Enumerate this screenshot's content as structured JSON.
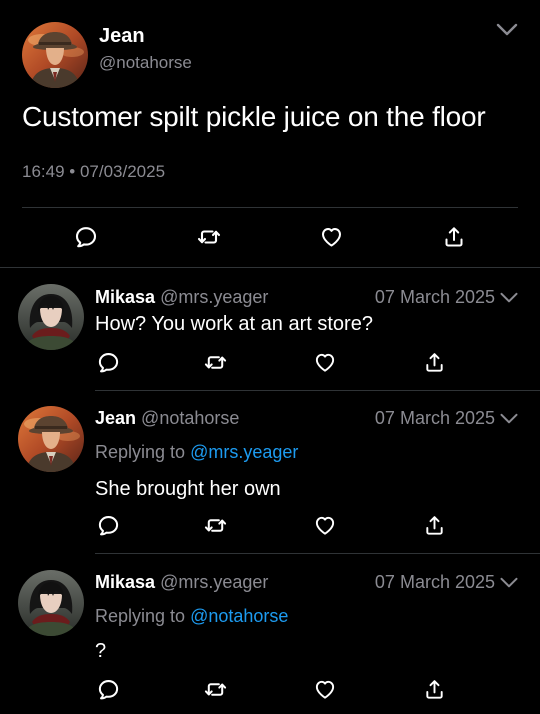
{
  "main_tweet": {
    "author_name": "Jean",
    "author_handle": "@notahorse",
    "text": "Customer spilt pickle juice on the floor",
    "timestamp": "16:49 • 07/03/2025",
    "icons": [
      "reply-icon",
      "retweet-icon",
      "like-icon",
      "share-icon"
    ]
  },
  "replies": [
    {
      "author_name": "Mikasa",
      "author_handle": "@mrs.yeager",
      "date": "07 March 2025",
      "replying_prefix": "",
      "replying_to": "",
      "text": "How? You work at an art store?"
    },
    {
      "author_name": "Jean",
      "author_handle": "@notahorse",
      "date": "07 March 2025",
      "replying_prefix": "Replying to",
      "replying_to": "@mrs.yeager",
      "text": "She brought her own"
    },
    {
      "author_name": "Mikasa",
      "author_handle": "@mrs.yeager",
      "date": "07 March 2025",
      "replying_prefix": "Replying to",
      "replying_to": "@notahorse",
      "text": "?"
    }
  ],
  "colors": {
    "background": "#000000",
    "primary_text": "#ffffff",
    "secondary_text": "#8b8b92",
    "mention": "#1d9bf0",
    "divider": "#2f3336"
  }
}
